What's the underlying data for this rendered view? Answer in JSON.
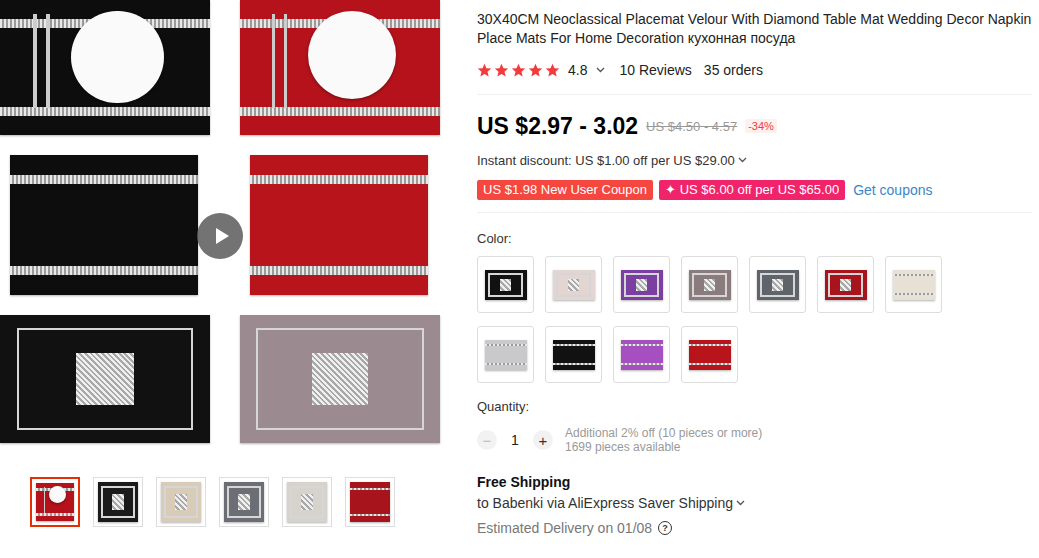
{
  "gallery": {
    "panels": [
      {
        "kind": "plate",
        "color": "#0d0d0d"
      },
      {
        "kind": "plate",
        "color": "#b5121b"
      },
      {
        "kind": "stripes",
        "color": "#0d0d0d"
      },
      {
        "kind": "stripes",
        "color": "#b8141c"
      },
      {
        "kind": "frame",
        "color": "#111111"
      },
      {
        "kind": "frame",
        "color": "#9b8a8f"
      }
    ],
    "thumbnails": [
      {
        "color": "#b5121b",
        "kind": "plate",
        "selected": true
      },
      {
        "color": "#1a1a1a",
        "kind": "frame",
        "selected": false
      },
      {
        "color": "#d8cbb8",
        "kind": "frame",
        "selected": false
      },
      {
        "color": "#6b6f75",
        "kind": "frame",
        "selected": false
      },
      {
        "color": "#d6d2cc",
        "kind": "frame",
        "selected": false
      },
      {
        "color": "#a8141b",
        "kind": "stripes",
        "selected": false
      }
    ]
  },
  "product": {
    "title": "30X40CM Neoclassical Placemat Velour With Diamond Table Mat Wedding Decor Napkin Place Mats For Home Decoration кухонная посуда"
  },
  "rating": {
    "stars": 5,
    "score": "4.8",
    "reviews": "10 Reviews",
    "orders": "35 orders"
  },
  "price": {
    "current": "US $2.97 - 3.02",
    "original": "US $4.50 - 4.57",
    "discount": "-34%"
  },
  "instant_discount": "Instant discount: US $1.00 off per US $29.00",
  "coupons": [
    {
      "label": "US $1.98 New User Coupon",
      "color": "#f5473f"
    },
    {
      "label": "✦ US $6.00 off per US $65.00",
      "color": "#f0236b"
    }
  ],
  "get_coupons": "Get coupons",
  "color": {
    "label": "Color:",
    "options": [
      {
        "kind": "frame",
        "color": "#111111"
      },
      {
        "kind": "frame",
        "color": "#e3d6d2"
      },
      {
        "kind": "frame",
        "color": "#7a3fa0"
      },
      {
        "kind": "frame",
        "color": "#8a7c7c"
      },
      {
        "kind": "frame",
        "color": "#5f636a"
      },
      {
        "kind": "frame",
        "color": "#a8141b"
      },
      {
        "kind": "stripes",
        "color": "#e6e0d5"
      },
      {
        "kind": "stripes",
        "color": "#c9c9cc"
      },
      {
        "kind": "stripes",
        "color": "#111111"
      },
      {
        "kind": "stripes",
        "color": "#a64fc0"
      },
      {
        "kind": "stripes",
        "color": "#b8141c"
      }
    ]
  },
  "quantity": {
    "label": "Quantity:",
    "minus": {
      "label": "−",
      "disabled": true
    },
    "value": "1",
    "plus": {
      "label": "+",
      "disabled": false
    },
    "bulk_note": "Additional 2% off (10 pieces or more)",
    "available": "1699 pieces available"
  },
  "shipping": {
    "title": "Free Shipping",
    "route": "to Babenki via AliExpress Saver Shipping",
    "delivery": "Estimated Delivery on 01/08",
    "help": "?"
  }
}
